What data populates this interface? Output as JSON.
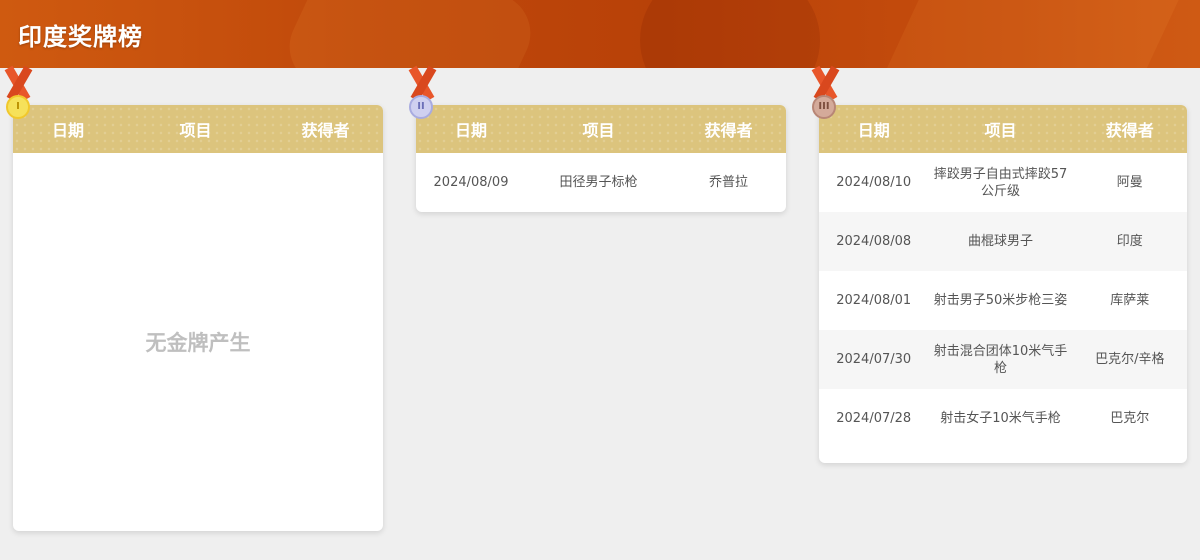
{
  "page": {
    "title": "印度奖牌榜"
  },
  "columns": {
    "date": "日期",
    "event": "项目",
    "winner": "获得者"
  },
  "medals": {
    "gold_symbol": "I",
    "silver_symbol": "II",
    "bronze_symbol": "III"
  },
  "gold": {
    "empty_text": "无金牌产生"
  },
  "silver": {
    "rows": [
      {
        "date": "2024/08/09",
        "event": "田径男子标枪",
        "winner": "乔普拉"
      }
    ]
  },
  "bronze": {
    "rows": [
      {
        "date": "2024/08/10",
        "event": "摔跤男子自由式摔跤57公斤级",
        "winner": "阿曼"
      },
      {
        "date": "2024/08/08",
        "event": "曲棍球男子",
        "winner": "印度"
      },
      {
        "date": "2024/08/01",
        "event": "射击男子50米步枪三姿",
        "winner": "库萨莱"
      },
      {
        "date": "2024/07/30",
        "event": "射击混合团体10米气手枪",
        "winner": "巴克尔/辛格"
      },
      {
        "date": "2024/07/28",
        "event": "射击女子10米气手枪",
        "winner": "巴克尔"
      }
    ]
  },
  "colors": {
    "header_bar": "#c0490b",
    "table_head": "#dcc47d",
    "gold": "#f6e15a",
    "silver": "#cfd0f0",
    "bronze": "#d4aa9a",
    "ribbon": "#e8562a"
  }
}
